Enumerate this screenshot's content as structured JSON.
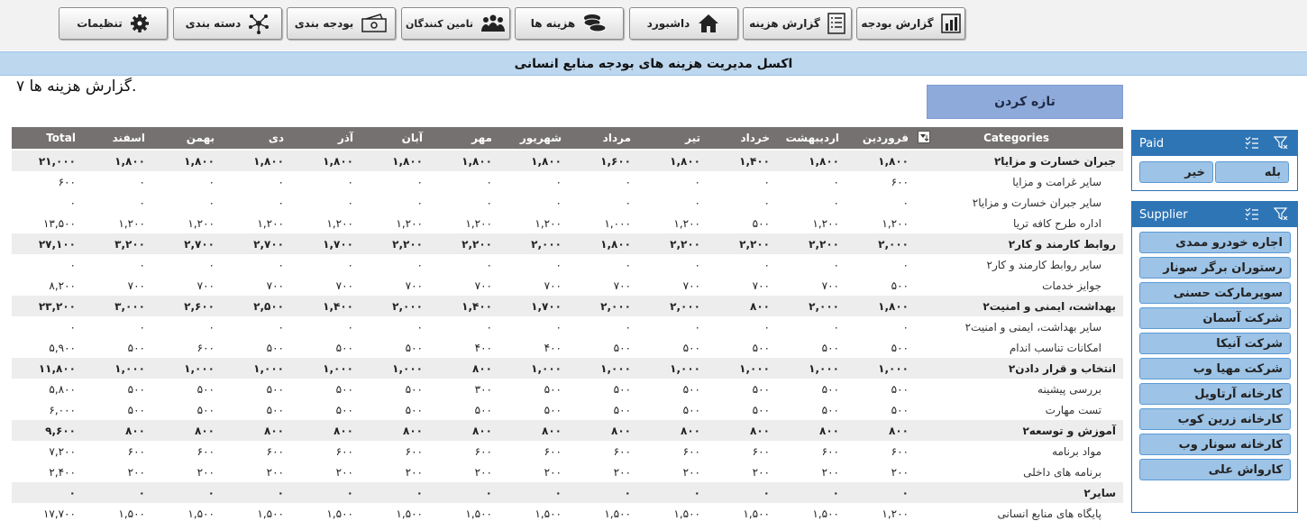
{
  "toolbar": {
    "buttons": [
      {
        "label": "گزارش بودجه",
        "icon": "bar-chart-icon"
      },
      {
        "label": "گزارش هزینه",
        "icon": "report-list-icon"
      },
      {
        "label": "داشبورد",
        "icon": "home-icon"
      },
      {
        "label": "هزینه ها",
        "icon": "coins-icon"
      },
      {
        "label": "تامین کنندگان",
        "icon": "people-icon"
      },
      {
        "label": "بودجه بندی",
        "icon": "money-icon"
      },
      {
        "label": "دسته بندی",
        "icon": "hub-icon"
      },
      {
        "label": "تنظیمات",
        "icon": "gear-icon"
      }
    ]
  },
  "title": "اکسل مدیریت هزینه های بودجه منابع انسانی",
  "subtitle": "گزارش هزینه ها ۷.",
  "refresh_label": "تازه کردن",
  "table": {
    "categories_header": "Categories",
    "total_header": "Total",
    "months": [
      "فروردین",
      "اردیبهشت",
      "خرداد",
      "تیر",
      "مرداد",
      "شهریور",
      "مهر",
      "آبان",
      "آذر",
      "دی",
      "بهمن",
      "اسفند"
    ],
    "rows": [
      {
        "type": "grp",
        "label": "جبران خسارت و مزایا۲",
        "values": [
          "۱,۸۰۰",
          "۱,۸۰۰",
          "۱,۴۰۰",
          "۱,۸۰۰",
          "۱,۶۰۰",
          "۱,۸۰۰",
          "۱,۸۰۰",
          "۱,۸۰۰",
          "۱,۸۰۰",
          "۱,۸۰۰",
          "۱,۸۰۰",
          "۱,۸۰۰"
        ],
        "total": "۲۱,۰۰۰"
      },
      {
        "type": "sub",
        "label": "سایر غرامت و مزایا",
        "values": [
          "۶۰۰",
          "۰",
          "۰",
          "۰",
          "۰",
          "۰",
          "۰",
          "۰",
          "۰",
          "۰",
          "۰",
          "۰"
        ],
        "total": "۶۰۰"
      },
      {
        "type": "sub",
        "label": "سایر جبران خسارت و مزایا۲",
        "values": [
          "۰",
          "۰",
          "۰",
          "۰",
          "۰",
          "۰",
          "۰",
          "۰",
          "۰",
          "۰",
          "۰",
          "۰"
        ],
        "total": "۰"
      },
      {
        "type": "sub",
        "label": "اداره طرح کافه تریا",
        "values": [
          "۱,۲۰۰",
          "۱,۲۰۰",
          "۵۰۰",
          "۱,۲۰۰",
          "۱,۰۰۰",
          "۱,۲۰۰",
          "۱,۲۰۰",
          "۱,۲۰۰",
          "۱,۲۰۰",
          "۱,۲۰۰",
          "۱,۲۰۰",
          "۱,۲۰۰"
        ],
        "total": "۱۳,۵۰۰"
      },
      {
        "type": "grp",
        "label": "روابط کارمند و کار۲",
        "values": [
          "۲,۰۰۰",
          "۲,۲۰۰",
          "۲,۲۰۰",
          "۲,۲۰۰",
          "۱,۸۰۰",
          "۲,۰۰۰",
          "۲,۲۰۰",
          "۲,۲۰۰",
          "۱,۷۰۰",
          "۲,۷۰۰",
          "۲,۷۰۰",
          "۳,۲۰۰"
        ],
        "total": "۲۷,۱۰۰"
      },
      {
        "type": "sub",
        "label": "سایر روابط کارمند و کار۲",
        "values": [
          "۰",
          "۰",
          "۰",
          "۰",
          "۰",
          "۰",
          "۰",
          "۰",
          "۰",
          "۰",
          "۰",
          "۰"
        ],
        "total": "۰"
      },
      {
        "type": "sub",
        "label": "جوایز خدمات",
        "values": [
          "۵۰۰",
          "۷۰۰",
          "۷۰۰",
          "۷۰۰",
          "۷۰۰",
          "۷۰۰",
          "۷۰۰",
          "۷۰۰",
          "۷۰۰",
          "۷۰۰",
          "۷۰۰",
          "۷۰۰"
        ],
        "total": "۸,۲۰۰"
      },
      {
        "type": "grp",
        "label": "بهداشت، ایمنی و امنیت۲",
        "values": [
          "۱,۸۰۰",
          "۲,۰۰۰",
          "۸۰۰",
          "۲,۰۰۰",
          "۲,۰۰۰",
          "۱,۷۰۰",
          "۱,۴۰۰",
          "۲,۰۰۰",
          "۱,۴۰۰",
          "۲,۵۰۰",
          "۲,۶۰۰",
          "۳,۰۰۰"
        ],
        "total": "۲۳,۲۰۰"
      },
      {
        "type": "sub",
        "label": "سایر بهداشت، ایمنی و امنیت۲",
        "values": [
          "۰",
          "۰",
          "۰",
          "۰",
          "۰",
          "۰",
          "۰",
          "۰",
          "۰",
          "۰",
          "۰",
          "۰"
        ],
        "total": "۰"
      },
      {
        "type": "sub",
        "label": "امکانات تناسب اندام",
        "values": [
          "۵۰۰",
          "۵۰۰",
          "۵۰۰",
          "۵۰۰",
          "۵۰۰",
          "۴۰۰",
          "۴۰۰",
          "۵۰۰",
          "۵۰۰",
          "۵۰۰",
          "۶۰۰",
          "۵۰۰"
        ],
        "total": "۵,۹۰۰"
      },
      {
        "type": "grp",
        "label": "انتخاب و قرار دادن۲",
        "values": [
          "۱,۰۰۰",
          "۱,۰۰۰",
          "۱,۰۰۰",
          "۱,۰۰۰",
          "۱,۰۰۰",
          "۱,۰۰۰",
          "۸۰۰",
          "۱,۰۰۰",
          "۱,۰۰۰",
          "۱,۰۰۰",
          "۱,۰۰۰",
          "۱,۰۰۰"
        ],
        "total": "۱۱,۸۰۰"
      },
      {
        "type": "sub",
        "label": "بررسی پیشینه",
        "values": [
          "۵۰۰",
          "۵۰۰",
          "۵۰۰",
          "۵۰۰",
          "۵۰۰",
          "۵۰۰",
          "۳۰۰",
          "۵۰۰",
          "۵۰۰",
          "۵۰۰",
          "۵۰۰",
          "۵۰۰"
        ],
        "total": "۵,۸۰۰"
      },
      {
        "type": "sub",
        "label": "تست مهارت",
        "values": [
          "۵۰۰",
          "۵۰۰",
          "۵۰۰",
          "۵۰۰",
          "۵۰۰",
          "۵۰۰",
          "۵۰۰",
          "۵۰۰",
          "۵۰۰",
          "۵۰۰",
          "۵۰۰",
          "۵۰۰"
        ],
        "total": "۶,۰۰۰"
      },
      {
        "type": "grp",
        "label": "آموزش و توسعه۲",
        "values": [
          "۸۰۰",
          "۸۰۰",
          "۸۰۰",
          "۸۰۰",
          "۸۰۰",
          "۸۰۰",
          "۸۰۰",
          "۸۰۰",
          "۸۰۰",
          "۸۰۰",
          "۸۰۰",
          "۸۰۰"
        ],
        "total": "۹,۶۰۰"
      },
      {
        "type": "sub",
        "label": "مواد برنامه",
        "values": [
          "۶۰۰",
          "۶۰۰",
          "۶۰۰",
          "۶۰۰",
          "۶۰۰",
          "۶۰۰",
          "۶۰۰",
          "۶۰۰",
          "۶۰۰",
          "۶۰۰",
          "۶۰۰",
          "۶۰۰"
        ],
        "total": "۷,۲۰۰"
      },
      {
        "type": "sub",
        "label": "برنامه های داخلی",
        "values": [
          "۲۰۰",
          "۲۰۰",
          "۲۰۰",
          "۲۰۰",
          "۲۰۰",
          "۲۰۰",
          "۲۰۰",
          "۲۰۰",
          "۲۰۰",
          "۲۰۰",
          "۲۰۰",
          "۲۰۰"
        ],
        "total": "۲,۴۰۰"
      },
      {
        "type": "grp",
        "label": "سایر۲",
        "values": [
          "۰",
          "۰",
          "۰",
          "۰",
          "۰",
          "۰",
          "۰",
          "۰",
          "۰",
          "۰",
          "۰",
          "۰"
        ],
        "total": "۰"
      },
      {
        "type": "sub",
        "label": "پایگاه های منابع انسانی",
        "values": [
          "۱,۲۰۰",
          "۱,۵۰۰",
          "۱,۵۰۰",
          "۱,۵۰۰",
          "۱,۵۰۰",
          "۱,۵۰۰",
          "۱,۵۰۰",
          "۱,۵۰۰",
          "۱,۵۰۰",
          "۱,۵۰۰",
          "۱,۵۰۰",
          "۱,۵۰۰"
        ],
        "total": "۱۷,۷۰۰"
      }
    ]
  },
  "paid_slicer": {
    "title": "Paid",
    "items": [
      "بله",
      "خیر"
    ]
  },
  "supplier_slicer": {
    "title": "Supplier",
    "items": [
      "اجاره خودرو ممدی",
      "رستوران برگر سونار",
      "سوپرمارکت حسنی",
      "شرکت آسمان",
      "شرکت آنیکا",
      "شرکت مهیا وب",
      "کارخانه آرتاویل",
      "کارخانه زرین کوب",
      "کارخانه سونار وب",
      "کارواش علی"
    ]
  },
  "colors": {
    "header": "#767171",
    "group_row": "#ededed",
    "slicer_header": "#2e75b6",
    "slicer_item": "#9dc3e6",
    "refresh": "#8eaadb",
    "title_bar": "#bdd7ee"
  }
}
